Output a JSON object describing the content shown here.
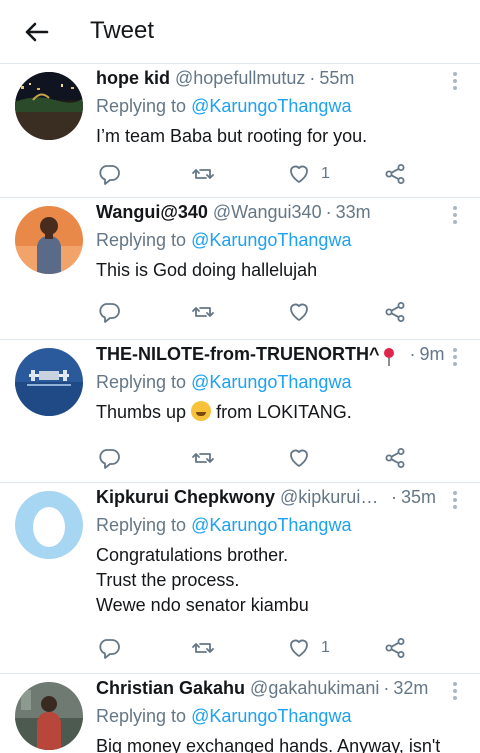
{
  "header": {
    "title": "Tweet",
    "back_icon": "arrow-left-icon"
  },
  "colors": {
    "accent": "#1da1f2",
    "muted": "#657786",
    "divider": "#e1e8ed"
  },
  "tweets": [
    {
      "name": "hope kid",
      "handle": "@hopefullmutuz",
      "sep": "·",
      "time": "55m",
      "replying_prefix": "Replying to",
      "replying_to": "@KarungoThangwa",
      "lines": [
        "I’m team Baba but rooting for you."
      ],
      "likes": "1"
    },
    {
      "name": "Wangui@340",
      "handle": "@Wangui340",
      "sep": "·",
      "time": "33m",
      "replying_prefix": "Replying to",
      "replying_to": "@KarungoThangwa",
      "lines": [
        "This is God doing hallelujah"
      ],
      "likes": ""
    },
    {
      "name": "THE-NILOTE-from-TRUENORTH^",
      "name_icon": "round-pushpin-emoji",
      "handle": "…",
      "sep": "·",
      "time": "9m",
      "replying_prefix": "Replying to",
      "replying_to": "@KarungoThangwa",
      "lines": [
        "Thumbs up",
        "from LOKITANG."
      ],
      "emoji": "rolling-laughing-emoji",
      "likes": ""
    },
    {
      "name": "Kipkurui Chepkwony",
      "handle": "@kipkuruiche…",
      "sep": "·",
      "time": "35m",
      "replying_prefix": "Replying to",
      "replying_to": "@KarungoThangwa",
      "lines": [
        "Congratulations brother.",
        "Trust the process.",
        "Wewe ndo senator kiambu"
      ],
      "likes": "1"
    },
    {
      "name": "Christian Gakahu",
      "handle": "@gakahukimani",
      "sep": "·",
      "time": "32m",
      "replying_prefix": "Replying to",
      "replying_to": "@KarungoThangwa",
      "lines": [
        "Big money exchanged hands. Anyway, isn't"
      ],
      "likes": ""
    }
  ]
}
